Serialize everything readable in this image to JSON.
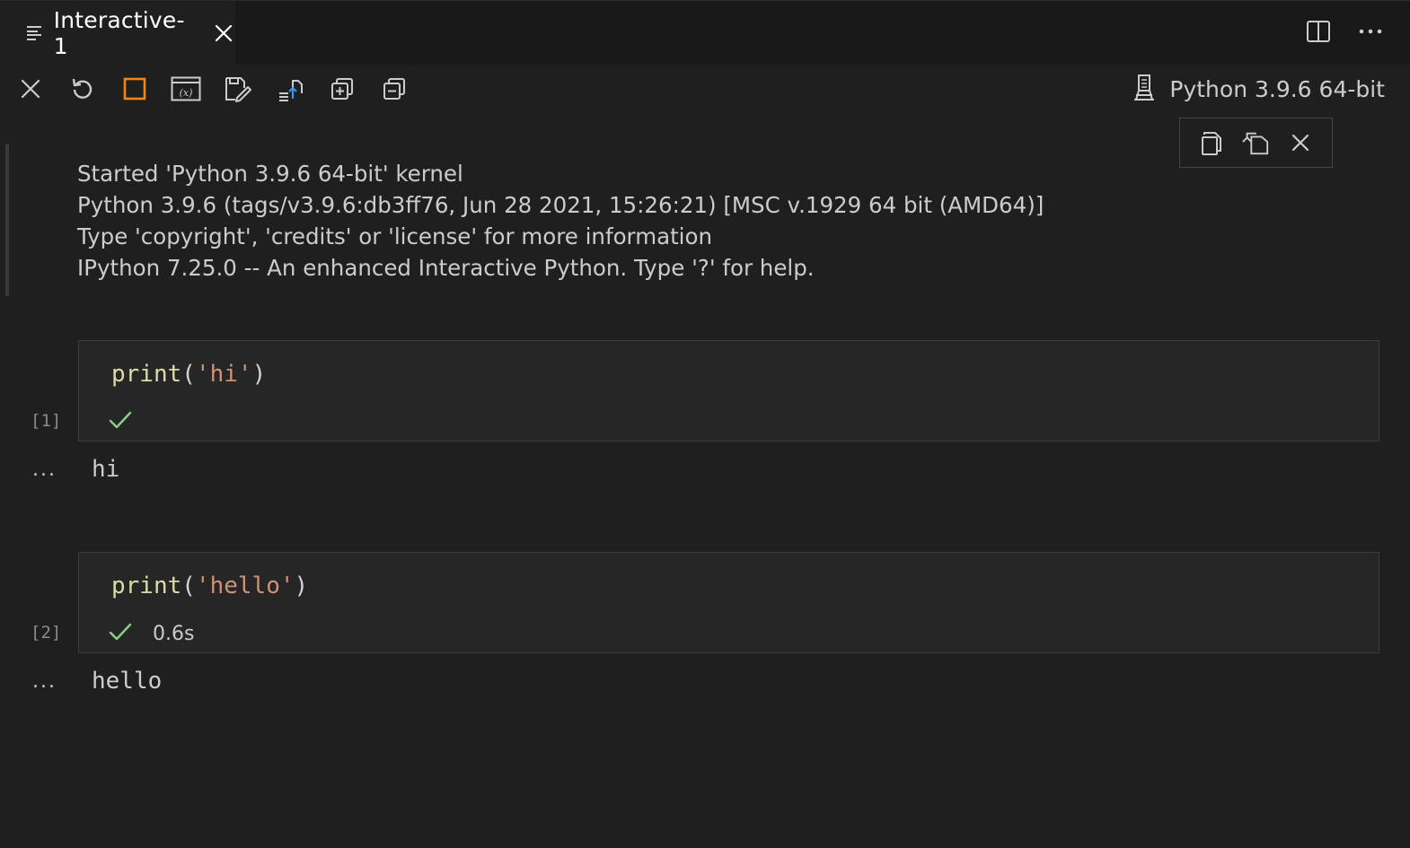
{
  "tab": {
    "title": "Interactive-1"
  },
  "editor_actions": [
    {
      "icon": "split-editor-icon"
    },
    {
      "icon": "more-actions-icon"
    }
  ],
  "toolbar": {
    "tools": [
      {
        "icon": "clear-all-icon"
      },
      {
        "icon": "restart-icon"
      },
      {
        "icon": "interrupt-icon"
      },
      {
        "icon": "variables-icon"
      },
      {
        "icon": "save-as-notebook-icon"
      },
      {
        "icon": "export-icon"
      },
      {
        "icon": "expand-all-icon"
      },
      {
        "icon": "collapse-all-icon"
      }
    ],
    "kernel": {
      "icon": "kernel-icon",
      "label": "Python 3.9.6 64-bit"
    }
  },
  "floating_tools": [
    {
      "icon": "copy-icon"
    },
    {
      "icon": "go-to-code-icon"
    },
    {
      "icon": "delete-icon"
    }
  ],
  "banner": [
    "Started 'Python 3.9.6 64-bit' kernel",
    "Python 3.9.6 (tags/v3.9.6:db3ff76, Jun 28 2021, 15:26:21) [MSC v.1929 64 bit (AMD64)]",
    "Type 'copyright', 'credits' or 'license' for more information",
    "IPython 7.25.0 -- An enhanced Interactive Python. Type '?' for help."
  ],
  "cells": [
    {
      "exec_count": "[1]",
      "code_fn": "print",
      "code_open": "(",
      "code_str": "'hi'",
      "code_close": ")",
      "duration": "",
      "output_marker": "...",
      "output": "hi"
    },
    {
      "exec_count": "[2]",
      "code_fn": "print",
      "code_open": "(",
      "code_str": "'hello'",
      "code_close": ")",
      "duration": "0.6s",
      "output_marker": "...",
      "output": "hello"
    }
  ],
  "colors": {
    "success": "#89d185",
    "interrupt": "#f38518",
    "background": "#1f1f1f"
  }
}
